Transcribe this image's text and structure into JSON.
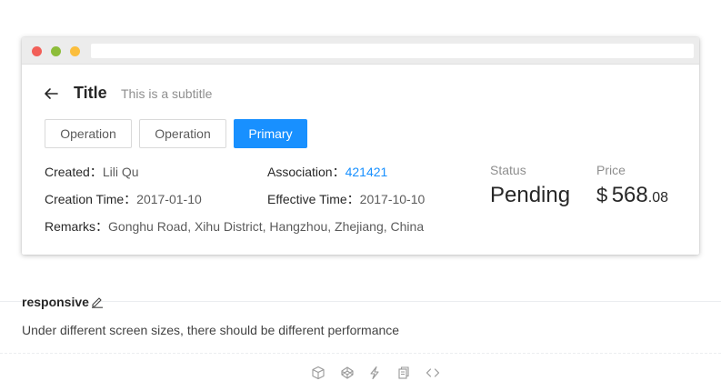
{
  "header": {
    "title": "Title",
    "subtitle": "This is a subtitle"
  },
  "actions": {
    "operation_1": "Operation",
    "operation_2": "Operation",
    "primary": "Primary"
  },
  "details": {
    "created_label": "Created：",
    "created_value": "Lili Qu",
    "association_label": "Association：",
    "association_value": "421421",
    "creation_time_label": "Creation Time：",
    "creation_time_value": "2017-01-10",
    "effective_time_label": "Effective Time：",
    "effective_time_value": "2017-10-10",
    "remarks_label": "Remarks：",
    "remarks_value": "Gonghu Road, Xihu District, Hangzhou, Zhejiang, China"
  },
  "stats": {
    "status_label": "Status",
    "status_value": "Pending",
    "price_label": "Price",
    "price_currency": "$",
    "price_integer": "568",
    "price_decimal": ".08"
  },
  "demo": {
    "section_title": "responsive",
    "description": "Under different screen sizes, there should be different performance"
  },
  "toolbar_icons": [
    "codesandbox-icon",
    "codepen-icon",
    "riddle-icon",
    "copy-icon",
    "code-expand-icon"
  ],
  "colors": {
    "primary": "#1890ff",
    "window_red": "#f25f58",
    "window_green": "#8dbd3a",
    "window_yellow": "#fbbe3d"
  }
}
